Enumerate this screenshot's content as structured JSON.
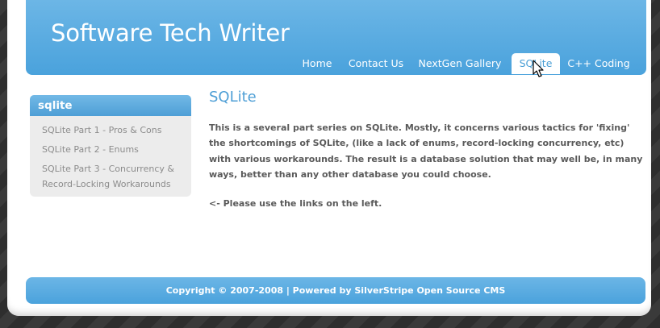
{
  "header": {
    "site_title": "Software Tech Writer",
    "nav": [
      {
        "label": "Home"
      },
      {
        "label": "Contact Us"
      },
      {
        "label": "NextGen Gallery"
      },
      {
        "label": "SQLite",
        "active": true
      },
      {
        "label": "C++ Coding"
      }
    ]
  },
  "sidebar": {
    "title": "sqlite",
    "links": [
      "SQLite Part 1 - Pros & Cons",
      "SQLite Part 2 - Enums",
      "SQLite Part 3 - Concurrency & Record-Locking Workarounds"
    ]
  },
  "content": {
    "title": "SQLite",
    "paragraph1": "This is a several part series on SQLite.  Mostly, it concerns various tactics for 'fixing' the shortcomings of SQLite, (like a lack of enums, record-locking concurrency, etc) with various workarounds.   The result is a database solution that may well be, in many ways, better than any other database you could choose.",
    "paragraph2": "<- Please use the links on the left."
  },
  "footer": {
    "text": "Copyright © 2007-2008 | Powered by SilverStripe Open Source CMS"
  },
  "colors": {
    "brand_blue": "#4aa2dc",
    "title_blue": "#4e9fd6",
    "body_text": "#5a5a5a",
    "sidebar_link": "#8c8c8c"
  },
  "icons": {
    "cursor": "mouse-pointer-icon"
  }
}
